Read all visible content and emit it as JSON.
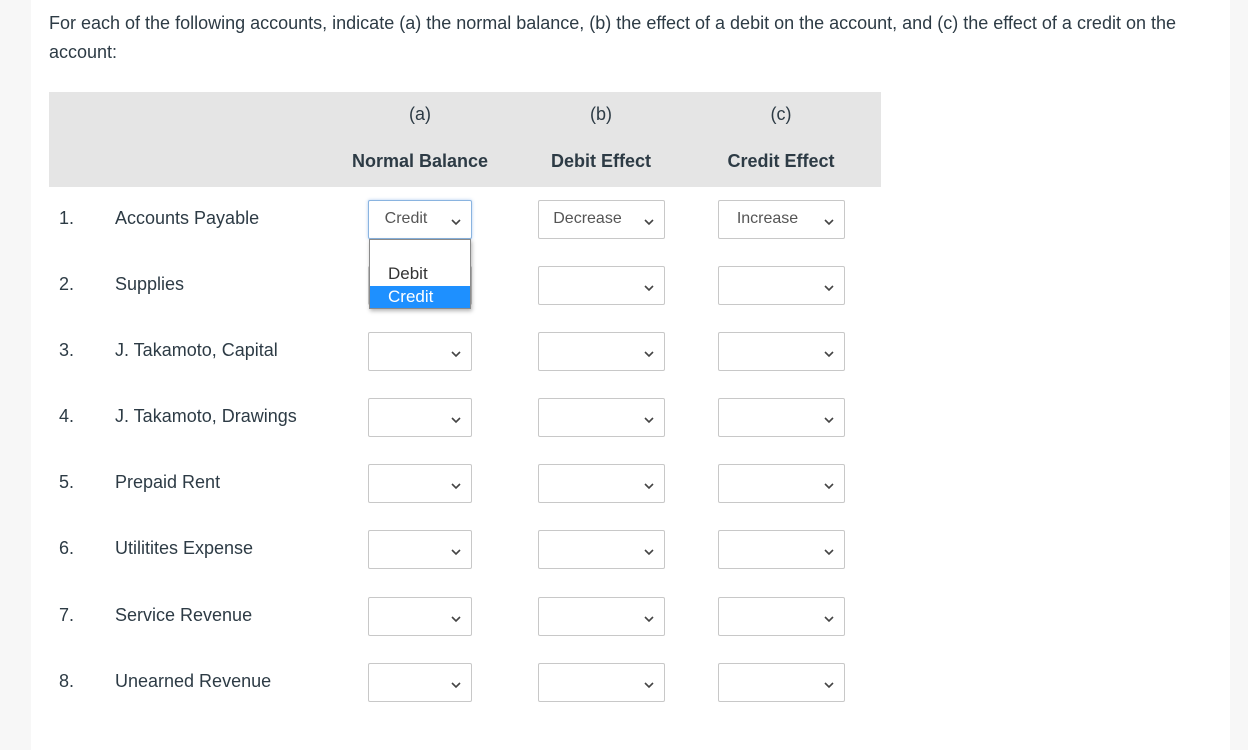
{
  "instructions": "For each of the following accounts, indicate (a) the normal balance, (b) the effect of a debit on the account, and (c) the effect of a credit on the account:",
  "columns": [
    {
      "letter": "(a)",
      "title": "Normal Balance"
    },
    {
      "letter": "(b)",
      "title": "Debit Effect"
    },
    {
      "letter": "(c)",
      "title": "Credit Effect"
    }
  ],
  "rows": [
    {
      "num": "1.",
      "account": "Accounts Payable",
      "normal_balance": "Credit",
      "debit_effect": "Decrease",
      "credit_effect": "Increase"
    },
    {
      "num": "2.",
      "account": "Supplies",
      "normal_balance": "",
      "debit_effect": "",
      "credit_effect": ""
    },
    {
      "num": "3.",
      "account": "J. Takamoto, Capital",
      "normal_balance": "",
      "debit_effect": "",
      "credit_effect": ""
    },
    {
      "num": "4.",
      "account": "J. Takamoto, Drawings",
      "normal_balance": "",
      "debit_effect": "",
      "credit_effect": ""
    },
    {
      "num": "5.",
      "account": "Prepaid Rent",
      "normal_balance": "",
      "debit_effect": "",
      "credit_effect": ""
    },
    {
      "num": "6.",
      "account": "Utilitites Expense",
      "normal_balance": "",
      "debit_effect": "",
      "credit_effect": ""
    },
    {
      "num": "7.",
      "account": "Service Revenue",
      "normal_balance": "",
      "debit_effect": "",
      "credit_effect": ""
    },
    {
      "num": "8.",
      "account": "Unearned Revenue",
      "normal_balance": "",
      "debit_effect": "",
      "credit_effect": ""
    }
  ],
  "open_dropdown": {
    "options": [
      "",
      "Debit",
      "Credit"
    ],
    "highlighted": "Credit"
  },
  "colors": {
    "header_bg": "#e5e5e5",
    "highlight": "#1e90ff",
    "text": "#2d3b45"
  }
}
